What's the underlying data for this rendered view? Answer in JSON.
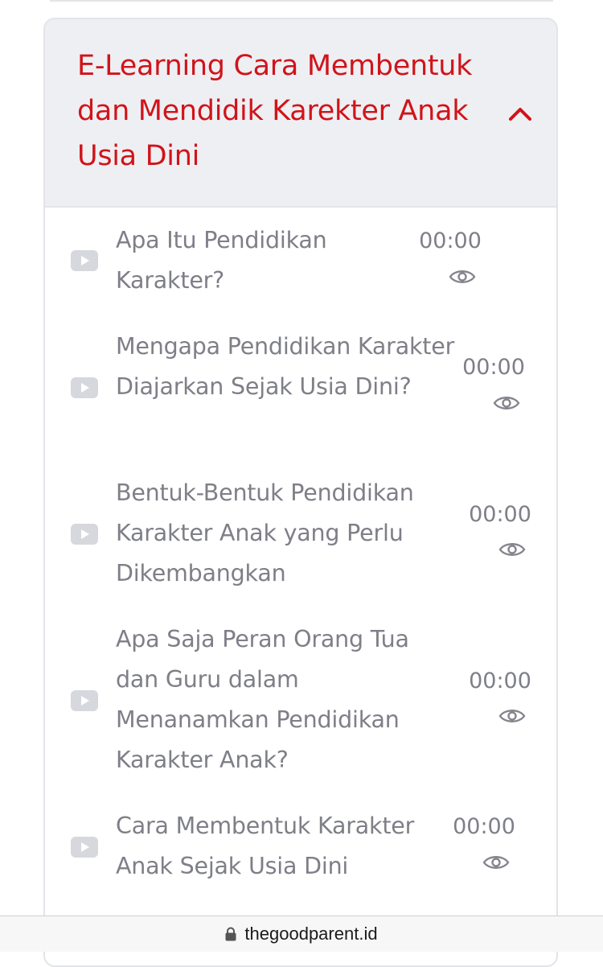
{
  "course": {
    "title": "E-Learning Cara Membentuk dan Mendidik Karekter Anak Usia Dini",
    "expanded": true
  },
  "lessons": [
    {
      "title": "Apa Itu Pendidikan Karakter?",
      "duration": "00:00"
    },
    {
      "title": "Mengapa Pendidikan Karakter Diajarkan Sejak Usia Dini?",
      "duration": "00:00"
    },
    {
      "title": "Bentuk-Bentuk Pendidikan Karakter Anak yang Perlu Dikembangkan",
      "duration": "00:00"
    },
    {
      "title": "Apa Saja Peran Orang Tua dan Guru dalam Menanamkan Pendidikan Karakter Anak?",
      "duration": "00:00"
    },
    {
      "title": "Cara Membentuk Karakter Anak Sejak Usia Dini",
      "duration": "00:00"
    }
  ],
  "browser": {
    "domain": "thegoodparent.id"
  },
  "colors": {
    "title_red": "#d0141a",
    "muted_text": "#7e7f87",
    "header_bg": "#eeeff3"
  }
}
